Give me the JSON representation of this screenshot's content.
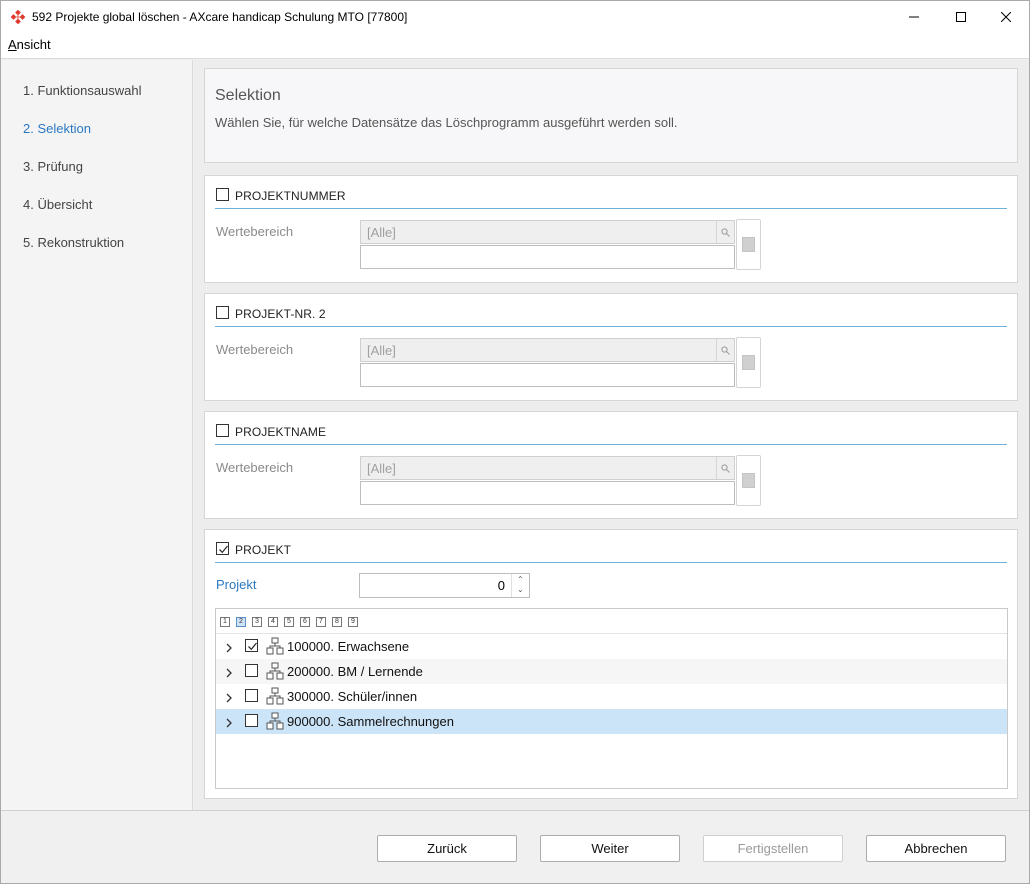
{
  "window": {
    "title": "592 Projekte global löschen - AXcare handicap Schulung MTO [77800]",
    "accent_color": "#2b79c2"
  },
  "menu": {
    "items": [
      {
        "prefix": "A",
        "rest": "nsicht"
      }
    ]
  },
  "steps": [
    {
      "label": "1. Funktionsauswahl",
      "active": false
    },
    {
      "label": "2. Selektion",
      "active": true
    },
    {
      "label": "3. Prüfung",
      "active": false
    },
    {
      "label": "4. Übersicht",
      "active": false
    },
    {
      "label": "5. Rekonstruktion",
      "active": false
    }
  ],
  "header": {
    "title": "Selektion",
    "subtitle": "Wählen Sie, für welche Datensätze das Löschprogramm ausgeführt werden soll."
  },
  "sections": [
    {
      "label": "PROJEKTNUMMER",
      "checked": false,
      "range_label": "Wertebereich",
      "placeholder": "[Alle]",
      "range_value": ""
    },
    {
      "label": "PROJEKT-NR. 2",
      "checked": false,
      "range_label": "Wertebereich",
      "placeholder": "[Alle]",
      "range_value": ""
    },
    {
      "label": "PROJEKTNAME",
      "checked": false,
      "range_label": "Wertebereich",
      "placeholder": "[Alle]",
      "range_value": ""
    }
  ],
  "projekt": {
    "label": "PROJEKT",
    "checked": true,
    "field_label": "Projekt",
    "count": "0",
    "levels": [
      "1",
      "2",
      "3",
      "4",
      "5",
      "6",
      "7",
      "8",
      "9"
    ],
    "selected_level": "2",
    "rows": [
      {
        "text": "100000. Erwachsene",
        "checked": true,
        "selected": false
      },
      {
        "text": "200000. BM / Lernende",
        "checked": false,
        "selected": false
      },
      {
        "text": "300000. Schüler/innen",
        "checked": false,
        "selected": false
      },
      {
        "text": "900000. Sammelrechnungen",
        "checked": false,
        "selected": true
      }
    ]
  },
  "buttons": {
    "back": "Zurück",
    "next": "Weiter",
    "finish": "Fertigstellen",
    "cancel": "Abbrechen"
  }
}
